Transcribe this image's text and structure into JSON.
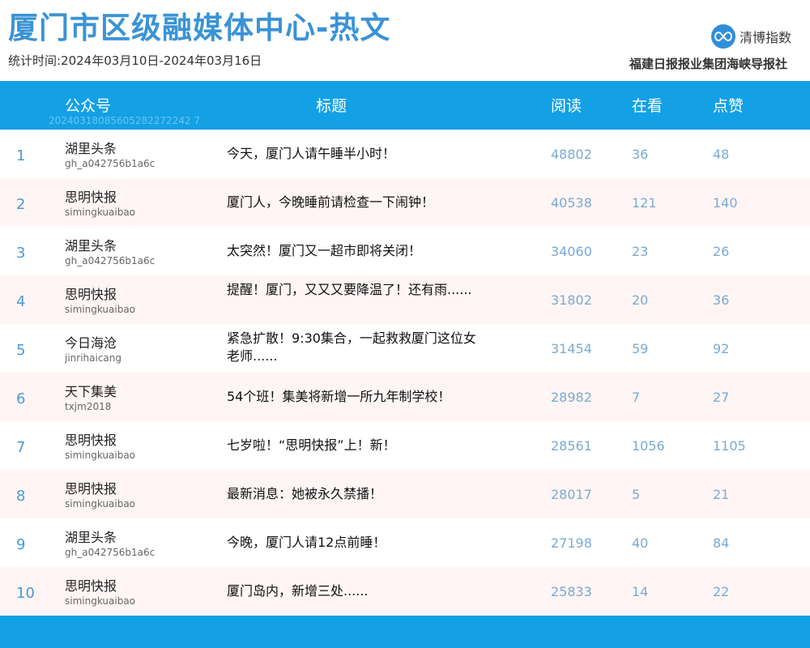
{
  "header": {
    "title": "厦门市区级融媒体中心-热文",
    "period": "统计时间:2024年03月10日-2024年03月16日",
    "logo_text": "清博指数",
    "publisher": "福建日报报业集团海峡导报社"
  },
  "table": {
    "columns": {
      "account": "公众号",
      "title": "标题",
      "reads": "阅读",
      "watching": "在看",
      "likes": "点赞"
    },
    "watermark": "20240318085605282272242 7",
    "rows": [
      {
        "rank": "1",
        "account": "湖里头条",
        "account_id": "gh_a042756b1a6c",
        "title": "今天，厦门人请午睡半小时！",
        "reads": "48802",
        "watching": "36",
        "likes": "48"
      },
      {
        "rank": "2",
        "account": "思明快报",
        "account_id": "simingkuaibao",
        "title": "厦门人，今晚睡前请检查一下闹钟！",
        "reads": "40538",
        "watching": "121",
        "likes": "140"
      },
      {
        "rank": "3",
        "account": "湖里头条",
        "account_id": "gh_a042756b1a6c",
        "title": "太突然！厦门又一超市即将关闭！",
        "reads": "34060",
        "watching": "23",
        "likes": "26"
      },
      {
        "rank": "4",
        "account": "思明快报",
        "account_id": "simingkuaibao",
        "title": "提醒！厦门，又又又要降温了！还有雨......",
        "reads": "31802",
        "watching": "20",
        "likes": "36"
      },
      {
        "rank": "5",
        "account": "今日海沧",
        "account_id": "jinrihaicang",
        "title": "紧急扩散！9:30集合，一起救救厦门这位女老师......",
        "reads": "31454",
        "watching": "59",
        "likes": "92"
      },
      {
        "rank": "6",
        "account": "天下集美",
        "account_id": "txjm2018",
        "title": "54个班！集美将新增一所九年制学校！",
        "reads": "28982",
        "watching": "7",
        "likes": "27"
      },
      {
        "rank": "7",
        "account": "思明快报",
        "account_id": "simingkuaibao",
        "title": "七岁啦！“思明快报”上！新！",
        "reads": "28561",
        "watching": "1056",
        "likes": "1105"
      },
      {
        "rank": "8",
        "account": "思明快报",
        "account_id": "simingkuaibao",
        "title": "最新消息：她被永久禁播！",
        "reads": "28017",
        "watching": "5",
        "likes": "21"
      },
      {
        "rank": "9",
        "account": "湖里头条",
        "account_id": "gh_a042756b1a6c",
        "title": "今晚，厦门人请12点前睡！",
        "reads": "27198",
        "watching": "40",
        "likes": "84"
      },
      {
        "rank": "10",
        "account": "思明快报",
        "account_id": "simingkuaibao",
        "title": "厦门岛内，新增三处......",
        "reads": "25833",
        "watching": "14",
        "likes": "22"
      }
    ]
  }
}
